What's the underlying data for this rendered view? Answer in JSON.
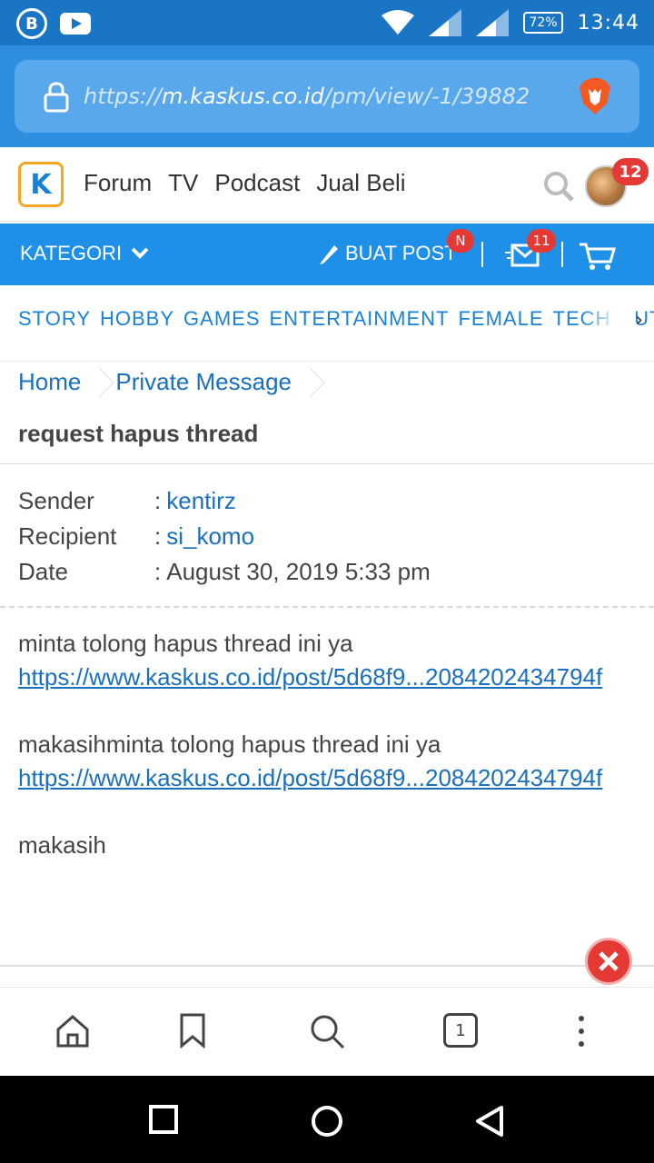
{
  "status_bar": {
    "b_icon": "B",
    "battery": "72%",
    "time": "13:44"
  },
  "address_bar": {
    "scheme": "https://",
    "host": "m.kaskus.co.id",
    "path": "/pm/view/-1/39882"
  },
  "site_nav": {
    "logo": "K",
    "links": [
      "Forum",
      "TV",
      "Podcast",
      "Jual Beli"
    ],
    "avatar_badge": "12"
  },
  "category_bar": {
    "kategori_label": "KATEGORI",
    "buat_post_label": "BUAT POST",
    "buat_post_badge": "N",
    "messages_badge": "11"
  },
  "categories": [
    "STORY",
    "HOBBY",
    "GAMES",
    "ENTERTAINMENT",
    "FEMALE",
    "TECH",
    "AUTO"
  ],
  "breadcrumb": [
    "Home",
    "Private Message"
  ],
  "message": {
    "title": "request hapus thread",
    "sender_label": "Sender",
    "sender": "kentirz",
    "recipient_label": "Recipient",
    "recipient": "si_komo",
    "date_label": "Date",
    "date": "August 30, 2019 5:33 pm",
    "line1": "minta tolong hapus thread ini ya",
    "link1": "https://www.kaskus.co.id/post/5d68f9...2084202434794f",
    "line2": "makasihminta tolong hapus thread ini ya",
    "link2": "https://www.kaskus.co.id/post/5d68f9...2084202434794f",
    "line3": "makasih"
  },
  "browser_bar": {
    "tab_count": "1"
  },
  "colors": {
    "status_bar": "#1a75c4",
    "address_bar": "#2e8ee0",
    "category_bar": "#1e90e8",
    "link": "#1a6fbf",
    "badge": "#e53935"
  }
}
